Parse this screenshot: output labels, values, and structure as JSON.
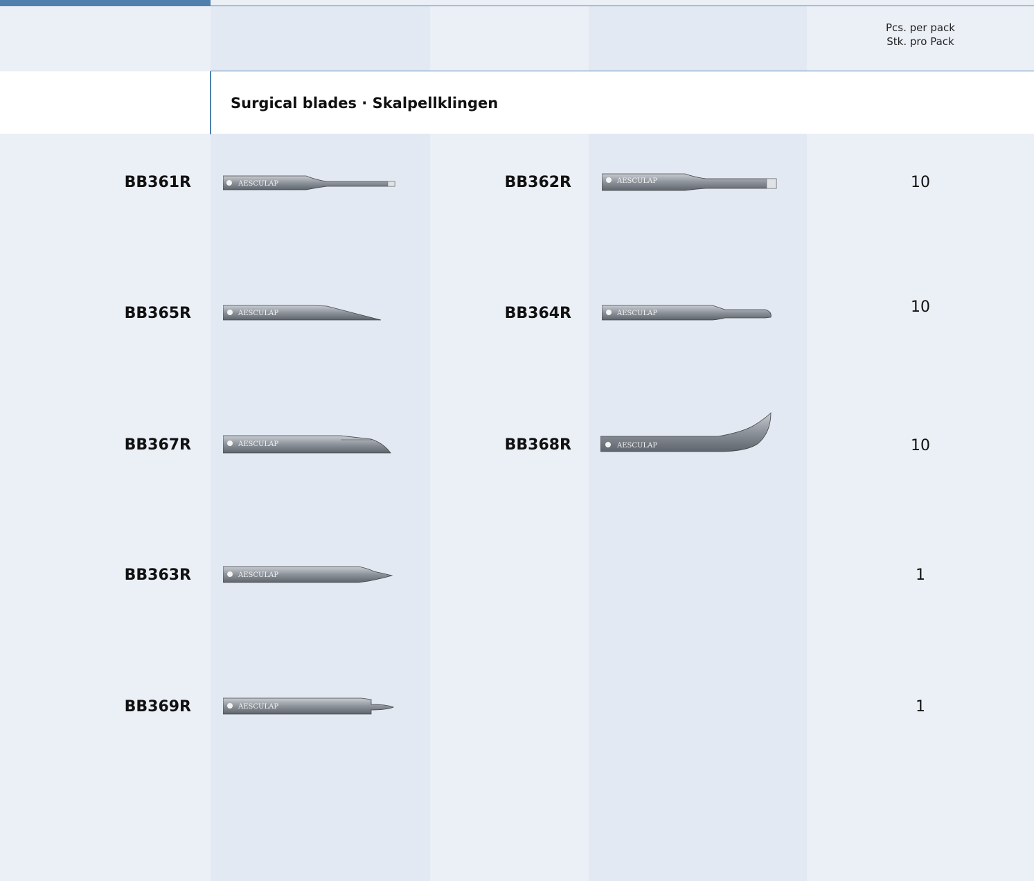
{
  "header": {
    "pack_line1": "Pcs. per pack",
    "pack_line2": "Stk. pro Pack"
  },
  "section": {
    "title": "Surgical blades · Skalpellklingen"
  },
  "brand": "AESCULAP",
  "rows": [
    {
      "left_code": "BB361R",
      "mid_code": "BB362R",
      "qty": "10"
    },
    {
      "left_code": "BB365R",
      "mid_code": "BB364R",
      "qty": "10"
    },
    {
      "left_code": "BB367R",
      "mid_code": "BB368R",
      "qty": "10"
    },
    {
      "left_code": "BB363R",
      "mid_code": "",
      "qty": "1"
    },
    {
      "left_code": "BB369R",
      "mid_code": "",
      "qty": "1"
    }
  ],
  "colors": {
    "accent": "#4f80ad",
    "band_light": "#ebeff6",
    "band_shade": "#e2e9f3"
  }
}
